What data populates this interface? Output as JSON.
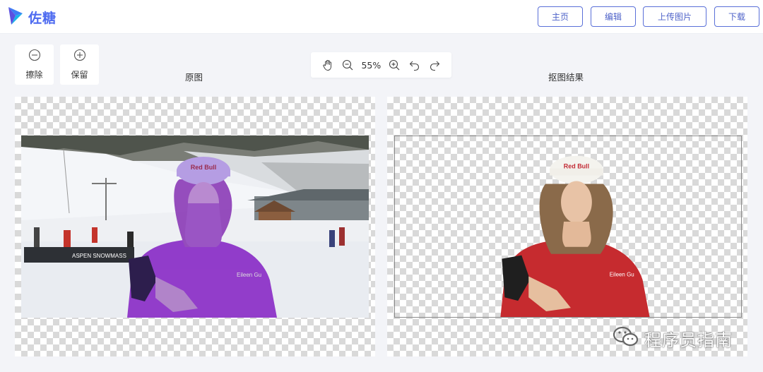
{
  "app": {
    "name": "佐糖",
    "logo_icon": "zuotang-logo-icon",
    "brand_color": "#4e6bf0"
  },
  "nav": {
    "home": "主页",
    "edit": "编辑",
    "upload": "上传图片",
    "download": "下载"
  },
  "tools": {
    "erase": {
      "label": "擦除",
      "icon": "minus-circle-icon"
    },
    "keep": {
      "label": "保留",
      "icon": "plus-circle-icon"
    }
  },
  "zoom": {
    "level": "55%",
    "icons": [
      "hand-icon",
      "zoom-out-icon",
      "zoom-in-icon",
      "undo-icon",
      "redo-icon"
    ]
  },
  "panels": {
    "original": {
      "title": "原图"
    },
    "result": {
      "title": "抠图结果"
    }
  },
  "photo": {
    "sign_text": "ASPEN SNOWMASS",
    "cap_logo": "Red Bull",
    "jacket_text": "Eileen Gu"
  },
  "watermark": {
    "text": "程序员指南",
    "icon": "wechat-icon"
  }
}
